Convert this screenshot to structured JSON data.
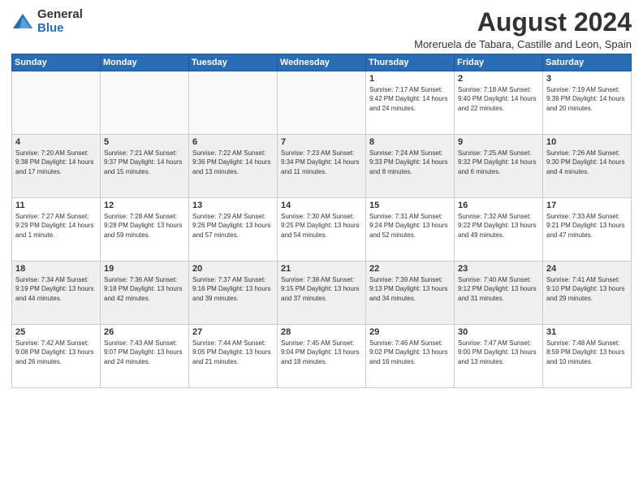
{
  "logo": {
    "general": "General",
    "blue": "Blue"
  },
  "title": "August 2024",
  "subtitle": "Moreruela de Tabara, Castille and Leon, Spain",
  "days_of_week": [
    "Sunday",
    "Monday",
    "Tuesday",
    "Wednesday",
    "Thursday",
    "Friday",
    "Saturday"
  ],
  "weeks": [
    [
      {
        "day": "",
        "info": ""
      },
      {
        "day": "",
        "info": ""
      },
      {
        "day": "",
        "info": ""
      },
      {
        "day": "",
        "info": ""
      },
      {
        "day": "1",
        "info": "Sunrise: 7:17 AM\nSunset: 9:42 PM\nDaylight: 14 hours\nand 24 minutes."
      },
      {
        "day": "2",
        "info": "Sunrise: 7:18 AM\nSunset: 9:40 PM\nDaylight: 14 hours\nand 22 minutes."
      },
      {
        "day": "3",
        "info": "Sunrise: 7:19 AM\nSunset: 9:39 PM\nDaylight: 14 hours\nand 20 minutes."
      }
    ],
    [
      {
        "day": "4",
        "info": "Sunrise: 7:20 AM\nSunset: 9:38 PM\nDaylight: 14 hours\nand 17 minutes."
      },
      {
        "day": "5",
        "info": "Sunrise: 7:21 AM\nSunset: 9:37 PM\nDaylight: 14 hours\nand 15 minutes."
      },
      {
        "day": "6",
        "info": "Sunrise: 7:22 AM\nSunset: 9:36 PM\nDaylight: 14 hours\nand 13 minutes."
      },
      {
        "day": "7",
        "info": "Sunrise: 7:23 AM\nSunset: 9:34 PM\nDaylight: 14 hours\nand 11 minutes."
      },
      {
        "day": "8",
        "info": "Sunrise: 7:24 AM\nSunset: 9:33 PM\nDaylight: 14 hours\nand 8 minutes."
      },
      {
        "day": "9",
        "info": "Sunrise: 7:25 AM\nSunset: 9:32 PM\nDaylight: 14 hours\nand 6 minutes."
      },
      {
        "day": "10",
        "info": "Sunrise: 7:26 AM\nSunset: 9:30 PM\nDaylight: 14 hours\nand 4 minutes."
      }
    ],
    [
      {
        "day": "11",
        "info": "Sunrise: 7:27 AM\nSunset: 9:29 PM\nDaylight: 14 hours\nand 1 minute."
      },
      {
        "day": "12",
        "info": "Sunrise: 7:28 AM\nSunset: 9:28 PM\nDaylight: 13 hours\nand 59 minutes."
      },
      {
        "day": "13",
        "info": "Sunrise: 7:29 AM\nSunset: 9:26 PM\nDaylight: 13 hours\nand 57 minutes."
      },
      {
        "day": "14",
        "info": "Sunrise: 7:30 AM\nSunset: 9:25 PM\nDaylight: 13 hours\nand 54 minutes."
      },
      {
        "day": "15",
        "info": "Sunrise: 7:31 AM\nSunset: 9:24 PM\nDaylight: 13 hours\nand 52 minutes."
      },
      {
        "day": "16",
        "info": "Sunrise: 7:32 AM\nSunset: 9:22 PM\nDaylight: 13 hours\nand 49 minutes."
      },
      {
        "day": "17",
        "info": "Sunrise: 7:33 AM\nSunset: 9:21 PM\nDaylight: 13 hours\nand 47 minutes."
      }
    ],
    [
      {
        "day": "18",
        "info": "Sunrise: 7:34 AM\nSunset: 9:19 PM\nDaylight: 13 hours\nand 44 minutes."
      },
      {
        "day": "19",
        "info": "Sunrise: 7:36 AM\nSunset: 9:18 PM\nDaylight: 13 hours\nand 42 minutes."
      },
      {
        "day": "20",
        "info": "Sunrise: 7:37 AM\nSunset: 9:16 PM\nDaylight: 13 hours\nand 39 minutes."
      },
      {
        "day": "21",
        "info": "Sunrise: 7:38 AM\nSunset: 9:15 PM\nDaylight: 13 hours\nand 37 minutes."
      },
      {
        "day": "22",
        "info": "Sunrise: 7:39 AM\nSunset: 9:13 PM\nDaylight: 13 hours\nand 34 minutes."
      },
      {
        "day": "23",
        "info": "Sunrise: 7:40 AM\nSunset: 9:12 PM\nDaylight: 13 hours\nand 31 minutes."
      },
      {
        "day": "24",
        "info": "Sunrise: 7:41 AM\nSunset: 9:10 PM\nDaylight: 13 hours\nand 29 minutes."
      }
    ],
    [
      {
        "day": "25",
        "info": "Sunrise: 7:42 AM\nSunset: 9:08 PM\nDaylight: 13 hours\nand 26 minutes."
      },
      {
        "day": "26",
        "info": "Sunrise: 7:43 AM\nSunset: 9:07 PM\nDaylight: 13 hours\nand 24 minutes."
      },
      {
        "day": "27",
        "info": "Sunrise: 7:44 AM\nSunset: 9:05 PM\nDaylight: 13 hours\nand 21 minutes."
      },
      {
        "day": "28",
        "info": "Sunrise: 7:45 AM\nSunset: 9:04 PM\nDaylight: 13 hours\nand 18 minutes."
      },
      {
        "day": "29",
        "info": "Sunrise: 7:46 AM\nSunset: 9:02 PM\nDaylight: 13 hours\nand 16 minutes."
      },
      {
        "day": "30",
        "info": "Sunrise: 7:47 AM\nSunset: 9:00 PM\nDaylight: 13 hours\nand 13 minutes."
      },
      {
        "day": "31",
        "info": "Sunrise: 7:48 AM\nSunset: 8:59 PM\nDaylight: 13 hours\nand 10 minutes."
      }
    ]
  ]
}
